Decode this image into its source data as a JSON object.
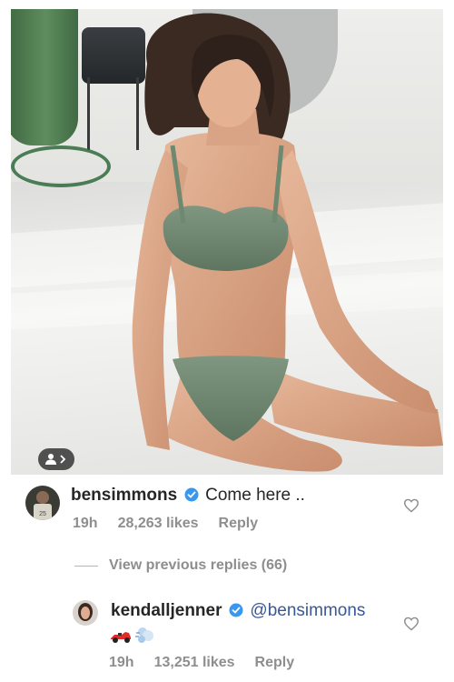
{
  "post": {
    "tag_icon": "person-tag-icon"
  },
  "comments": [
    {
      "username": "bensimmons",
      "text": "Come here ..",
      "time": "19h",
      "likes": "28,263 likes",
      "reply_label": "Reply",
      "avatar_icon": "user-avatar",
      "verified_icon": "verified-badge-icon",
      "like_icon": "heart-icon"
    }
  ],
  "view_previous": "View previous replies (66)",
  "replies": [
    {
      "username": "kendalljenner",
      "mention": "@bensimmons",
      "emojis": "race-car-emoji, dash-emoji",
      "time": "19h",
      "likes": "13,251 likes",
      "reply_label": "Reply",
      "avatar_icon": "user-avatar",
      "verified_icon": "verified-badge-icon",
      "like_icon": "heart-icon"
    }
  ],
  "colors": {
    "verified_blue": "#3897f0",
    "mention_blue": "#385898",
    "meta_gray": "#8e8e8e",
    "text_dark": "#262626"
  }
}
